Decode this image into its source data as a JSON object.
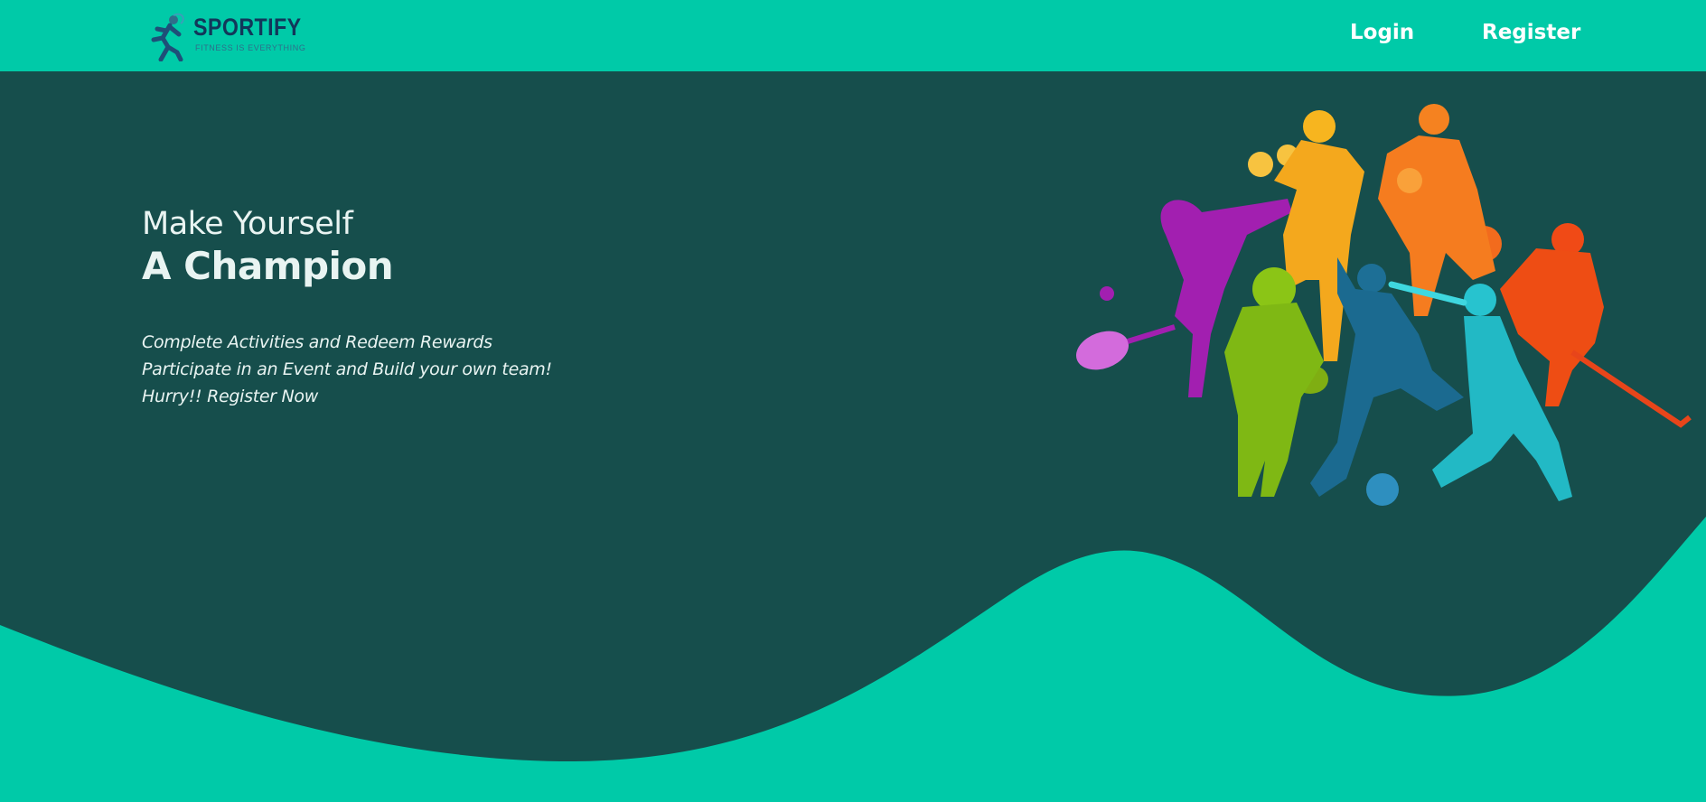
{
  "brand": {
    "name": "SPORTIFY",
    "tagline": "FITNESS IS EVERYTHING",
    "logo_icon": "runner-icon"
  },
  "nav": {
    "login_label": "Login",
    "register_label": "Register"
  },
  "hero": {
    "line1": "Make Yourself",
    "line2": "A Champion",
    "points": [
      "Complete Activities and Redeem Rewards",
      "Participate in an Event and Build your own team!",
      "Hurry!! Register Now"
    ],
    "illustration": "sports-players-illustration"
  },
  "colors": {
    "navbar": "#00caa8",
    "hero_background": "#164e4c",
    "wave": "#00caa8",
    "text": "#e9f4f2",
    "brand_text": "#12375a"
  }
}
